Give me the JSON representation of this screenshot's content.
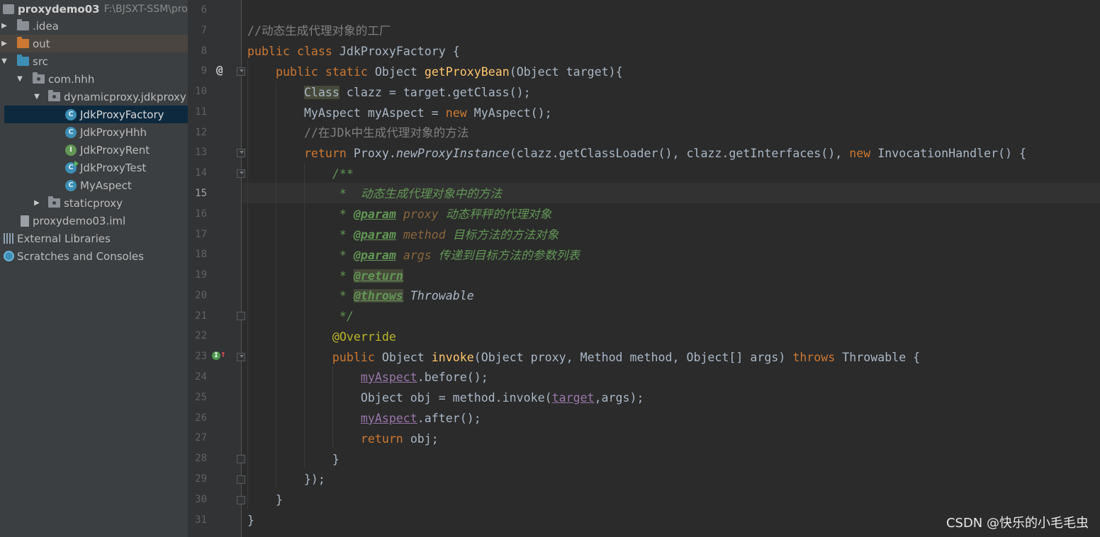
{
  "project_tree": {
    "root": {
      "name": "proxydemo03",
      "path": "F:\\BJSXT-SSM\\pro"
    },
    "idea": ".idea",
    "out": "out",
    "src": "src",
    "pkg_comhhh": "com.hhh",
    "pkg_dynamic": "dynamicproxy.jdkproxy",
    "classes": [
      "JdkProxyFactory",
      "JdkProxyHhh",
      "JdkProxyRent",
      "JdkProxyTest",
      "MyAspect"
    ],
    "pkg_static": "staticproxy",
    "iml": "proxydemo03.iml",
    "external_libraries": "External Libraries",
    "scratches": "Scratches and Consoles"
  },
  "editor": {
    "line_numbers": [
      "6",
      "7",
      "8",
      "9",
      "10",
      "11",
      "12",
      "13",
      "14",
      "15",
      "16",
      "17",
      "18",
      "19",
      "20",
      "21",
      "22",
      "23",
      "24",
      "25",
      "26",
      "27",
      "28",
      "29",
      "30",
      "31"
    ],
    "current_line": "15",
    "tokens": {
      "l7_comment": "//动态生成代理对象的工厂",
      "kw_public": "public",
      "kw_class": "class",
      "class_name": "JdkProxyFactory",
      "brace_open": "{",
      "kw_static": "static",
      "t_object": "Object",
      "m_getProxyBean": "getProxyBean",
      "l9_params": "(Object target){",
      "t_class": "Class",
      "l10_rest": "clazz = target.getClass();",
      "l11_decl": "MyAspect myAspect = ",
      "kw_new": "new",
      "l11_rest": "MyAspect();",
      "l12_comment": "//在JDk中生成代理对象的方法",
      "kw_return": "return",
      "l13_proxy": "Proxy.",
      "m_newProxyInstance": "newProxyInstance",
      "l13_args": "(clazz.getClassLoader(), clazz.getInterfaces(), ",
      "l13_handler": "InvocationHandler() {",
      "doc_open": "/**",
      "doc_star": "*",
      "doc_desc": "  动态生成代理对象中的方法",
      "tag_param": "@param",
      "p_proxy": "proxy",
      "d_proxy": " 动态秤秤的代理对象",
      "p_method": "method",
      "d_method": " 目标方法的方法对象",
      "p_args": "args",
      "d_args": " 传递到目标方法的参数列表",
      "tag_return": "@return",
      "tag_throws": "@throws",
      "d_throwable": "Throwable",
      "doc_close": "*/",
      "ann_override": "@Override",
      "m_invoke": "invoke",
      "l23_params": "(Object proxy, Method method, Object[] args) ",
      "kw_throws": "throws",
      "l23_tail": "Throwable {",
      "f_myAspect": "myAspect",
      "l24_rest": ".before();",
      "l25_decl": "Object obj = method.invoke(",
      "f_target": "target",
      "l25_rest": ",args);",
      "l26_rest": ".after();",
      "l27_rest": "obj;",
      "brace_close": "}",
      "l29": "});"
    },
    "gutter_marks": {
      "l9": "@",
      "l23": "I↑"
    }
  },
  "watermark": "CSDN @快乐的小毛毛虫"
}
